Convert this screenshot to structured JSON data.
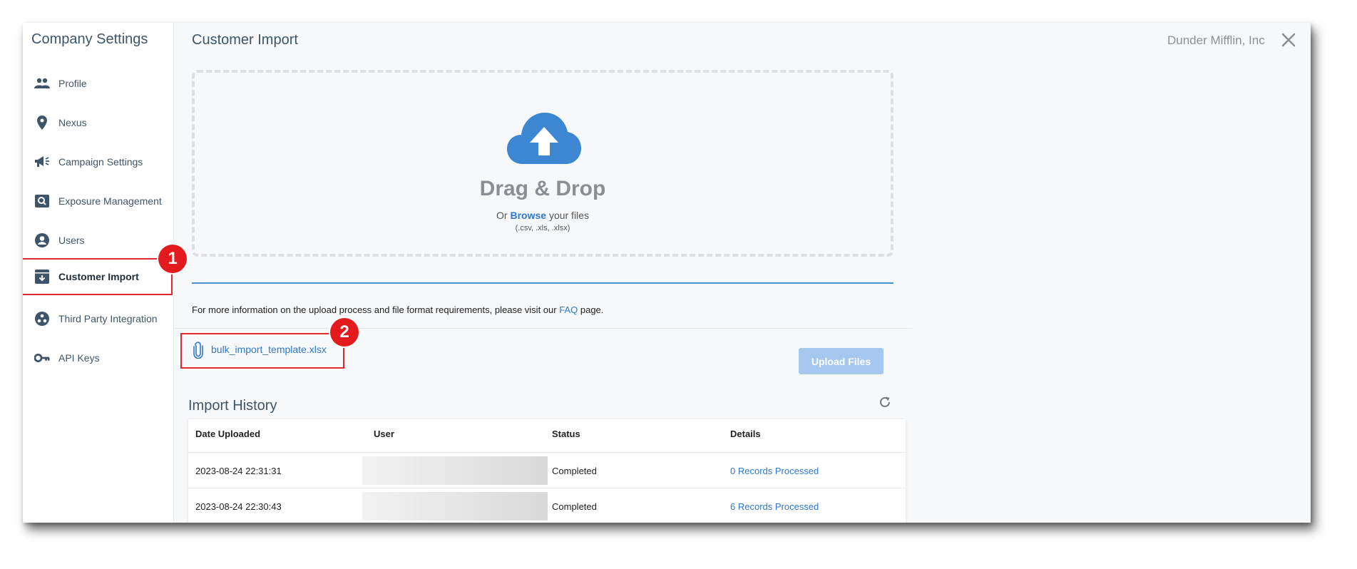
{
  "sidebar": {
    "title": "Company Settings",
    "items": [
      {
        "label": "Profile",
        "icon": "people-icon"
      },
      {
        "label": "Nexus",
        "icon": "location-pin-icon"
      },
      {
        "label": "Campaign Settings",
        "icon": "megaphone-icon"
      },
      {
        "label": "Exposure Management",
        "icon": "search-box-icon"
      },
      {
        "label": "Users",
        "icon": "user-circle-icon"
      },
      {
        "label": "Customer Import",
        "icon": "import-box-icon",
        "active": true
      },
      {
        "label": "Third Party Integration",
        "icon": "integration-icon"
      },
      {
        "label": "API Keys",
        "icon": "key-icon"
      }
    ]
  },
  "badges": {
    "one": "1",
    "two": "2"
  },
  "header": {
    "title": "Customer Import",
    "company": "Dunder Mifflin, Inc"
  },
  "dropzone": {
    "title": "Drag & Drop",
    "or": "Or",
    "browse": "Browse",
    "your_files": "your files",
    "types": "(.csv, .xls, .xlsx)"
  },
  "info": {
    "prefix": "For more information on the upload process and file format requirements, please visit our",
    "faq": "FAQ",
    "suffix": "page."
  },
  "template_file": "bulk_import_template.xlsx",
  "upload_button": "Upload Files",
  "history": {
    "title": "Import History",
    "columns": [
      "Date Uploaded",
      "User",
      "Status",
      "Details"
    ],
    "rows": [
      {
        "date": "2023-08-24 22:31:31",
        "user": "",
        "status": "Completed",
        "details": "0 Records Processed"
      },
      {
        "date": "2023-08-24 22:30:43",
        "user": "",
        "status": "Completed",
        "details": "6 Records Processed"
      }
    ]
  },
  "colors": {
    "accent": "#2e79c9",
    "highlight": "#e0282e",
    "cloud": "#3d86d1"
  }
}
